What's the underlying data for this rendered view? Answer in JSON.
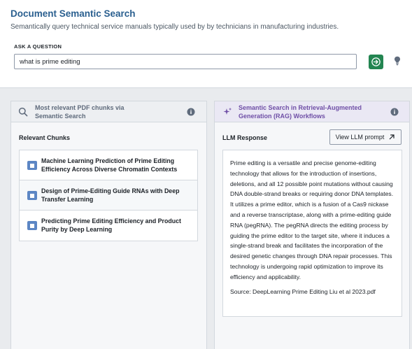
{
  "header": {
    "title": "Document Semantic Search",
    "subtitle": "Semantically query technical service manuals typically used by by technicians in manufacturing industries."
  },
  "ask": {
    "label": "ASK A QUESTION",
    "value": "what is prime editing"
  },
  "icons": {
    "submit": "arrow-right-circle-icon",
    "bulb": "lightbulb-icon",
    "search": "search-icon",
    "info": "info-icon",
    "sparkle": "sparkle-icon",
    "document": "document-icon",
    "external": "arrow-top-right-icon"
  },
  "left_panel": {
    "title": "Most relevant PDF chunks via Semantic Search",
    "section_title": "Relevant Chunks",
    "chunks": [
      {
        "title": "Machine Learning Prediction of Prime Editing Efficiency Across Diverse Chromatin Contexts"
      },
      {
        "title": "Design of Prime-Editing Guide RNAs with Deep Transfer Learning"
      },
      {
        "title": "Predicting Prime Editing Efficiency and Product Purity by Deep Learning"
      }
    ]
  },
  "right_panel": {
    "title": "Semantic Search in Retrieval-Augmented Generation (RAG) Workflows",
    "section_title": "LLM Response",
    "view_button": "View LLM prompt",
    "response": "Prime editing is a versatile and precise genome-editing technology that allows for the introduction of insertions, deletions, and all 12 possible point mutations without causing DNA double-strand breaks or requiring donor DNA templates. It utilizes a prime editor, which is a fusion of a Cas9 nickase and a reverse transcriptase, along with a prime-editing guide RNA (pegRNA). The pegRNA directs the editing process by guiding the prime editor to the target site, where it induces a single-strand break and facilitates the incorporation of the desired genetic changes through DNA repair processes. This technology is undergoing rapid optimization to improve its efficiency and applicability.",
    "source": "Source: DeepLearning Prime Editing Liu et al 2023.pdf"
  },
  "colors": {
    "title_blue": "#2a5f8f",
    "submit_green": "#238551",
    "rag_purple": "#6f4fa6",
    "doc_blue": "#5c86c4"
  }
}
